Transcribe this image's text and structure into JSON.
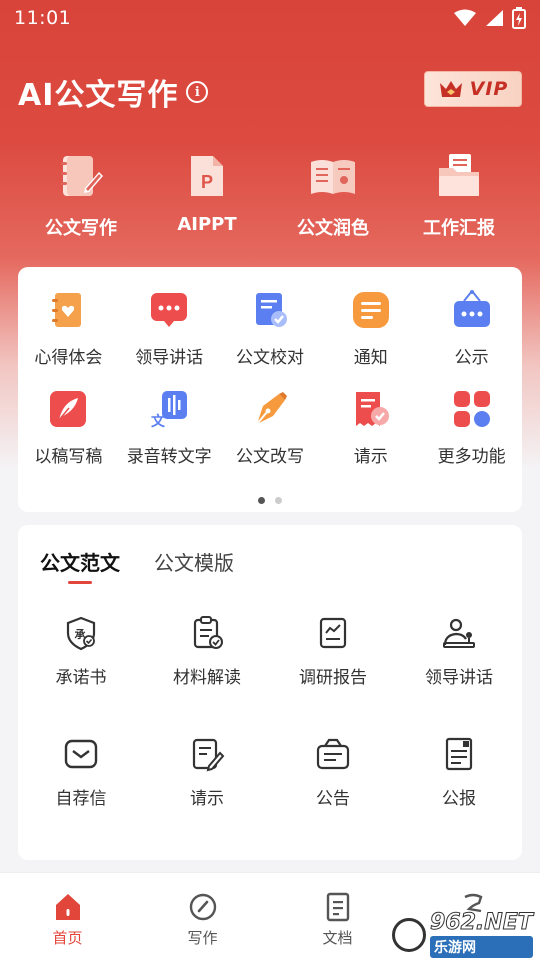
{
  "status_bar": {
    "time": "11:01"
  },
  "header": {
    "title": "AI公文写作",
    "info_glyph": "i",
    "vip_label": "VIP"
  },
  "quick_actions": [
    {
      "label": "公文写作",
      "icon": "notebook-pen-icon"
    },
    {
      "label": "AIPPT",
      "icon": "ppt-file-icon"
    },
    {
      "label": "公文润色",
      "icon": "open-book-icon"
    },
    {
      "label": "工作汇报",
      "icon": "folder-doc-icon"
    }
  ],
  "tools": [
    {
      "label": "心得体会",
      "icon": "journal-heart-icon"
    },
    {
      "label": "领导讲话",
      "icon": "chat-bubble-icon"
    },
    {
      "label": "公文校对",
      "icon": "doc-check-icon"
    },
    {
      "label": "通知",
      "icon": "notice-icon"
    },
    {
      "label": "公示",
      "icon": "signboard-icon"
    },
    {
      "label": "以稿写稿",
      "icon": "quill-icon"
    },
    {
      "label": "录音转文字",
      "icon": "voice-text-icon"
    },
    {
      "label": "公文改写",
      "icon": "pen-nib-icon"
    },
    {
      "label": "请示",
      "icon": "receipt-check-icon"
    },
    {
      "label": "更多功能",
      "icon": "apps-grid-icon"
    }
  ],
  "samples": {
    "tabs": [
      {
        "label": "公文范文"
      },
      {
        "label": "公文模版"
      }
    ],
    "items": [
      {
        "label": "承诺书",
        "icon": "shield-seal-icon"
      },
      {
        "label": "材料解读",
        "icon": "clipboard-check-icon"
      },
      {
        "label": "调研报告",
        "icon": "report-chart-icon"
      },
      {
        "label": "领导讲话",
        "icon": "podium-speaker-icon"
      },
      {
        "label": "自荐信",
        "icon": "envelope-icon"
      },
      {
        "label": "请示",
        "icon": "doc-edit-icon"
      },
      {
        "label": "公告",
        "icon": "announcement-icon"
      },
      {
        "label": "公报",
        "icon": "newspaper-icon"
      }
    ]
  },
  "bottom_nav": [
    {
      "label": "首页",
      "icon": "home-icon"
    },
    {
      "label": "写作",
      "icon": "compass-icon"
    },
    {
      "label": "文档",
      "icon": "document-icon"
    },
    {
      "label": "",
      "icon": "profile-icon"
    }
  ],
  "watermark": {
    "main": "962.NET",
    "sub": "乐游网"
  },
  "colors": {
    "brand_red": "#d9443a",
    "accent": "#e2463b"
  }
}
